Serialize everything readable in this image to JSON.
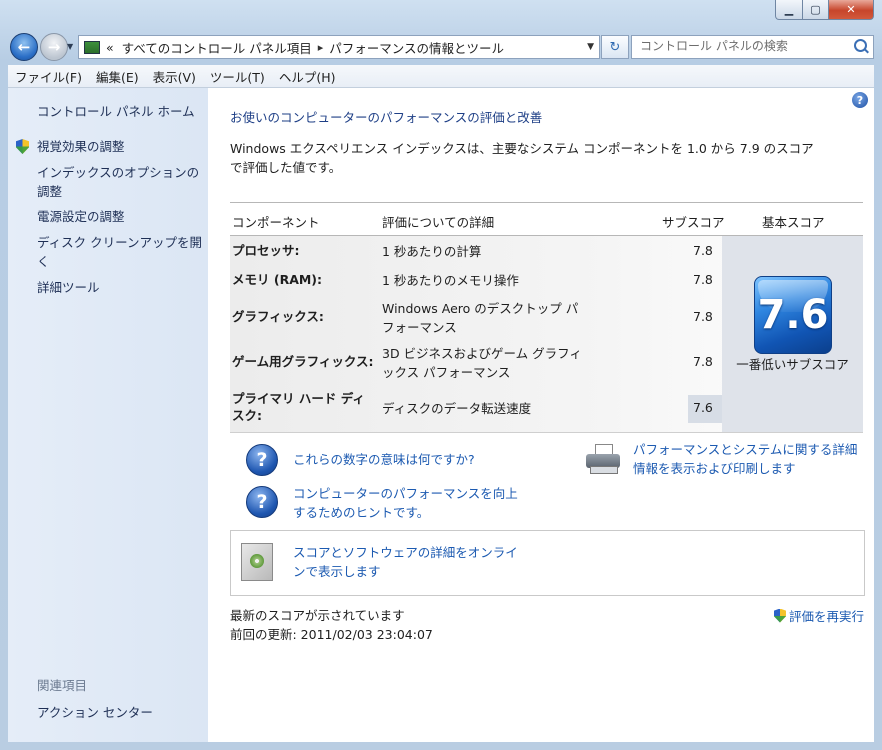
{
  "window": {
    "min_label": "▭",
    "max_label": "▢",
    "close_label": "✕"
  },
  "address": {
    "chevron": "«",
    "crumbs": [
      "すべてのコントロール パネル項目",
      "パフォーマンスの情報とツール"
    ],
    "separator": "▸"
  },
  "search": {
    "placeholder": "コントロール パネルの検索"
  },
  "menu": [
    "ファイル(F)",
    "編集(E)",
    "表示(V)",
    "ツール(T)",
    "ヘルプ(H)"
  ],
  "sidebar": {
    "home": "コントロール パネル ホーム",
    "items": [
      "視覚効果の調整",
      "インデックスのオプションの調整",
      "電源設定の調整",
      "ディスク クリーンアップを開く",
      "詳細ツール"
    ],
    "related_header": "関連項目",
    "related": [
      "アクション センター"
    ]
  },
  "main": {
    "heading": "お使いのコンピューターのパフォーマンスの評価と改善",
    "intro": "Windows エクスペリエンス インデックスは、主要なシステム コンポーネントを 1.0 から 7.9 のスコアで評価した値です。",
    "table": {
      "headers": [
        "コンポーネント",
        "評価についての詳細",
        "サブスコア",
        "基本スコア"
      ],
      "rows": [
        {
          "component": "プロセッサ:",
          "detail": "1 秒あたりの計算",
          "subscore": "7.8"
        },
        {
          "component": "メモリ (RAM):",
          "detail": "1 秒あたりのメモリ操作",
          "subscore": "7.8"
        },
        {
          "component": "グラフィックス:",
          "detail": "Windows Aero のデスクトップ パフォーマンス",
          "subscore": "7.8"
        },
        {
          "component": "ゲーム用グラフィックス:",
          "detail": "3D ビジネスおよびゲーム グラフィックス パフォーマンス",
          "subscore": "7.8"
        },
        {
          "component": "プライマリ ハード ディスク:",
          "detail": "ディスクのデータ転送速度",
          "subscore": "7.6"
        }
      ],
      "base_score": "7.6",
      "base_caption": "一番低いサブスコア"
    },
    "links": {
      "what_mean": "これらの数字の意味は何ですか?",
      "tips": "コンピューターのパフォーマンスを向上するためのヒントです。",
      "print": "パフォーマンスとシステムに関する詳細情報を表示および印刷します",
      "online": "スコアとソフトウェアの詳細をオンラインで表示します"
    },
    "status": {
      "line1": "最新のスコアが示されています",
      "line2": "前回の更新: 2011/02/03 23:04:07",
      "rerun": "評価を再実行"
    }
  }
}
